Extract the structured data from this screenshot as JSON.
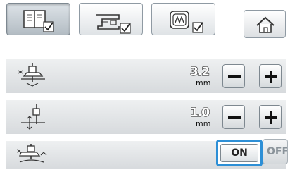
{
  "tabs": [
    {
      "icon": "utility-stitch-book-icon",
      "active": true
    },
    {
      "icon": "sewing-machine-icon",
      "active": false
    },
    {
      "icon": "embroidery-frame-icon",
      "active": false
    }
  ],
  "home": {
    "icon": "home-icon"
  },
  "settings": [
    {
      "name": "stitch-width",
      "icon": "presser-foot-width-icon",
      "value": "3.2",
      "unit": "mm"
    },
    {
      "name": "stitch-length",
      "icon": "presser-foot-length-icon",
      "value": "1.0",
      "unit": "mm"
    },
    {
      "name": "pivot",
      "icon": "presser-foot-pivot-icon",
      "on_label": "ON",
      "off_label": "OFF",
      "state": "on"
    }
  ],
  "colors": {
    "accent": "#2d8fd6",
    "row_bg": "#e4e7e9"
  }
}
